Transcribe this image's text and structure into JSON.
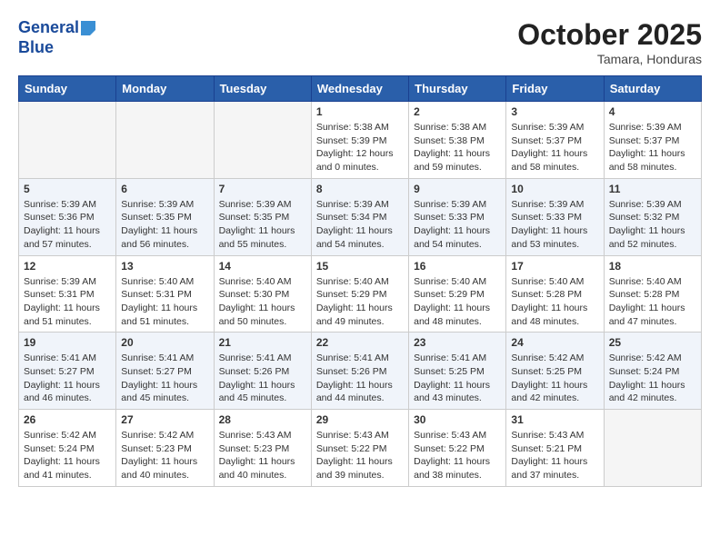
{
  "header": {
    "logo_line1": "General",
    "logo_line2": "Blue",
    "month": "October 2025",
    "location": "Tamara, Honduras"
  },
  "weekdays": [
    "Sunday",
    "Monday",
    "Tuesday",
    "Wednesday",
    "Thursday",
    "Friday",
    "Saturday"
  ],
  "weeks": [
    [
      {
        "day": "",
        "info": ""
      },
      {
        "day": "",
        "info": ""
      },
      {
        "day": "",
        "info": ""
      },
      {
        "day": "1",
        "info": "Sunrise: 5:38 AM\nSunset: 5:39 PM\nDaylight: 12 hours\nand 0 minutes."
      },
      {
        "day": "2",
        "info": "Sunrise: 5:38 AM\nSunset: 5:38 PM\nDaylight: 11 hours\nand 59 minutes."
      },
      {
        "day": "3",
        "info": "Sunrise: 5:39 AM\nSunset: 5:37 PM\nDaylight: 11 hours\nand 58 minutes."
      },
      {
        "day": "4",
        "info": "Sunrise: 5:39 AM\nSunset: 5:37 PM\nDaylight: 11 hours\nand 58 minutes."
      }
    ],
    [
      {
        "day": "5",
        "info": "Sunrise: 5:39 AM\nSunset: 5:36 PM\nDaylight: 11 hours\nand 57 minutes."
      },
      {
        "day": "6",
        "info": "Sunrise: 5:39 AM\nSunset: 5:35 PM\nDaylight: 11 hours\nand 56 minutes."
      },
      {
        "day": "7",
        "info": "Sunrise: 5:39 AM\nSunset: 5:35 PM\nDaylight: 11 hours\nand 55 minutes."
      },
      {
        "day": "8",
        "info": "Sunrise: 5:39 AM\nSunset: 5:34 PM\nDaylight: 11 hours\nand 54 minutes."
      },
      {
        "day": "9",
        "info": "Sunrise: 5:39 AM\nSunset: 5:33 PM\nDaylight: 11 hours\nand 54 minutes."
      },
      {
        "day": "10",
        "info": "Sunrise: 5:39 AM\nSunset: 5:33 PM\nDaylight: 11 hours\nand 53 minutes."
      },
      {
        "day": "11",
        "info": "Sunrise: 5:39 AM\nSunset: 5:32 PM\nDaylight: 11 hours\nand 52 minutes."
      }
    ],
    [
      {
        "day": "12",
        "info": "Sunrise: 5:39 AM\nSunset: 5:31 PM\nDaylight: 11 hours\nand 51 minutes."
      },
      {
        "day": "13",
        "info": "Sunrise: 5:40 AM\nSunset: 5:31 PM\nDaylight: 11 hours\nand 51 minutes."
      },
      {
        "day": "14",
        "info": "Sunrise: 5:40 AM\nSunset: 5:30 PM\nDaylight: 11 hours\nand 50 minutes."
      },
      {
        "day": "15",
        "info": "Sunrise: 5:40 AM\nSunset: 5:29 PM\nDaylight: 11 hours\nand 49 minutes."
      },
      {
        "day": "16",
        "info": "Sunrise: 5:40 AM\nSunset: 5:29 PM\nDaylight: 11 hours\nand 48 minutes."
      },
      {
        "day": "17",
        "info": "Sunrise: 5:40 AM\nSunset: 5:28 PM\nDaylight: 11 hours\nand 48 minutes."
      },
      {
        "day": "18",
        "info": "Sunrise: 5:40 AM\nSunset: 5:28 PM\nDaylight: 11 hours\nand 47 minutes."
      }
    ],
    [
      {
        "day": "19",
        "info": "Sunrise: 5:41 AM\nSunset: 5:27 PM\nDaylight: 11 hours\nand 46 minutes."
      },
      {
        "day": "20",
        "info": "Sunrise: 5:41 AM\nSunset: 5:27 PM\nDaylight: 11 hours\nand 45 minutes."
      },
      {
        "day": "21",
        "info": "Sunrise: 5:41 AM\nSunset: 5:26 PM\nDaylight: 11 hours\nand 45 minutes."
      },
      {
        "day": "22",
        "info": "Sunrise: 5:41 AM\nSunset: 5:26 PM\nDaylight: 11 hours\nand 44 minutes."
      },
      {
        "day": "23",
        "info": "Sunrise: 5:41 AM\nSunset: 5:25 PM\nDaylight: 11 hours\nand 43 minutes."
      },
      {
        "day": "24",
        "info": "Sunrise: 5:42 AM\nSunset: 5:25 PM\nDaylight: 11 hours\nand 42 minutes."
      },
      {
        "day": "25",
        "info": "Sunrise: 5:42 AM\nSunset: 5:24 PM\nDaylight: 11 hours\nand 42 minutes."
      }
    ],
    [
      {
        "day": "26",
        "info": "Sunrise: 5:42 AM\nSunset: 5:24 PM\nDaylight: 11 hours\nand 41 minutes."
      },
      {
        "day": "27",
        "info": "Sunrise: 5:42 AM\nSunset: 5:23 PM\nDaylight: 11 hours\nand 40 minutes."
      },
      {
        "day": "28",
        "info": "Sunrise: 5:43 AM\nSunset: 5:23 PM\nDaylight: 11 hours\nand 40 minutes."
      },
      {
        "day": "29",
        "info": "Sunrise: 5:43 AM\nSunset: 5:22 PM\nDaylight: 11 hours\nand 39 minutes."
      },
      {
        "day": "30",
        "info": "Sunrise: 5:43 AM\nSunset: 5:22 PM\nDaylight: 11 hours\nand 38 minutes."
      },
      {
        "day": "31",
        "info": "Sunrise: 5:43 AM\nSunset: 5:21 PM\nDaylight: 11 hours\nand 37 minutes."
      },
      {
        "day": "",
        "info": ""
      }
    ]
  ]
}
